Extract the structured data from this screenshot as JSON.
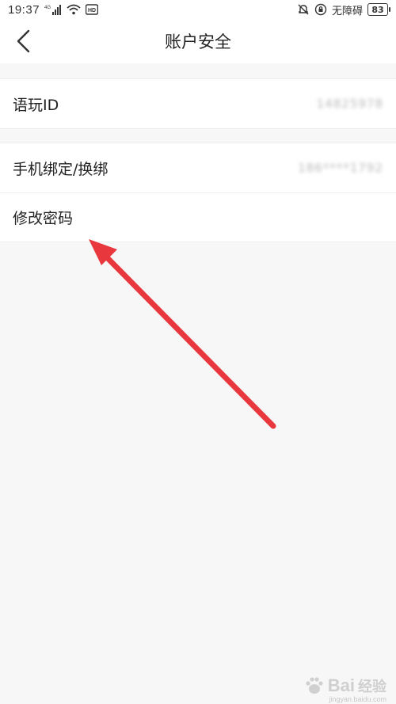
{
  "status_bar": {
    "time": "19:37",
    "network": "4G",
    "hd": "HD",
    "accessibility_text": "无障碍",
    "battery": "83"
  },
  "header": {
    "title": "账户安全"
  },
  "sections": [
    {
      "rows": [
        {
          "label": "语玩ID",
          "value": "14825978"
        }
      ]
    },
    {
      "rows": [
        {
          "label": "手机绑定/换绑",
          "value": "186****1792"
        },
        {
          "label": "修改密码",
          "value": ""
        }
      ]
    }
  ],
  "annotation": {
    "color": "#e8383d"
  },
  "watermark": {
    "brand": "Bai",
    "brand2": "经验",
    "url": "jingyan.baidu.com"
  },
  "colors": {
    "background": "#f7f7f7",
    "surface": "#ffffff",
    "text": "#222222",
    "muted": "#b8b8b8"
  }
}
